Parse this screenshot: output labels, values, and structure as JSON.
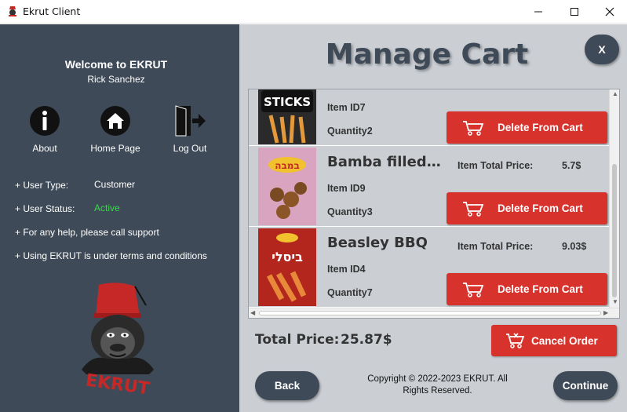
{
  "window": {
    "title": "Ekrut Client",
    "minimize_icon": "minimize-icon",
    "maximize_icon": "maximize-icon",
    "close_icon": "close-icon"
  },
  "sidebar": {
    "welcome": "Welcome to EKRUT",
    "username": "Rick Sanchez",
    "nav": [
      {
        "label": "About",
        "icon": "info-icon"
      },
      {
        "label": "Home Page",
        "icon": "home-icon"
      },
      {
        "label": "Log Out",
        "icon": "logout-icon"
      }
    ],
    "user_type_label": "+ User Type:",
    "user_type_value": "Customer",
    "user_status_label": "+ User Status:",
    "user_status_value": "Active",
    "user_status_color": "#33dd44",
    "support_line": "+ For any help, please call support",
    "terms_line": "+ Using EKRUT is under terms and conditions",
    "logo_text": "EKRUT",
    "bg_color": "#3e4a57"
  },
  "main": {
    "title": "Manage Cart",
    "close_label": "X",
    "cart_items": [
      {
        "name": "",
        "item_id": "Item ID7",
        "quantity": "Quantity2",
        "total_label": "",
        "total_value": "",
        "delete_label": "Delete From Cart",
        "thumb": "sticks-snack-thumbnail",
        "thumb_text": "STICKS"
      },
      {
        "name": "Bamba filled wi...",
        "item_id": "Item ID9",
        "quantity": "Quantity3",
        "total_label": "Item Total Price:",
        "total_value": "5.7$",
        "delete_label": "Delete From Cart",
        "thumb": "bamba-snack-thumbnail",
        "thumb_text": "במבה"
      },
      {
        "name": "Beasley BBQ",
        "item_id": "Item ID4",
        "quantity": "Quantity7",
        "total_label": "Item Total Price:",
        "total_value": "9.03$",
        "delete_label": "Delete From Cart",
        "thumb": "beasley-snack-thumbnail",
        "thumb_text": "ביסלי"
      }
    ],
    "total_label": "Total Price:",
    "total_value": "25.87$",
    "cancel_label": "Cancel Order",
    "back_label": "Back",
    "continue_label": "Continue",
    "copyright": "Copyright © 2022-2023 EKRUT. All Rights Reserved.",
    "accent_red": "#d8322c",
    "bg_color": "#cbcfd4"
  }
}
